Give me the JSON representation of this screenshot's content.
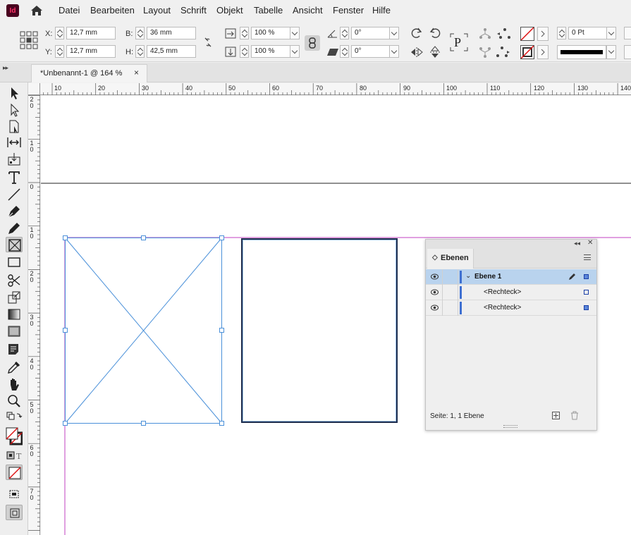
{
  "app": {
    "logo_text": "Id"
  },
  "menu": {
    "items": [
      {
        "label": "Datei"
      },
      {
        "label": "Bearbeiten"
      },
      {
        "label": "Layout"
      },
      {
        "label": "Schrift"
      },
      {
        "label": "Objekt"
      },
      {
        "label": "Tabelle"
      },
      {
        "label": "Ansicht"
      },
      {
        "label": "Fenster"
      },
      {
        "label": "Hilfe"
      }
    ]
  },
  "control": {
    "x_label": "X:",
    "x_value": "12,7 mm",
    "y_label": "Y:",
    "y_value": "12,7 mm",
    "w_label": "B:",
    "w_value": "36 mm",
    "h_label": "H:",
    "h_value": "42,5 mm",
    "scale_x": "100 %",
    "scale_y": "100 %",
    "rotation": "0°",
    "shear": "0°",
    "stroke_weight": "0 Pt",
    "para_icon_text": "P"
  },
  "tab": {
    "title": "*Unbenannt-1 @ 164 %",
    "close_glyph": "×"
  },
  "ruler": {
    "h_labels": [
      "10",
      "20",
      "30",
      "40",
      "50",
      "60",
      "70",
      "80",
      "90",
      "100",
      "110",
      "120",
      "130",
      "140"
    ],
    "v_labels": [
      "2 0",
      "1 0",
      "0",
      "1 0",
      "2 0",
      "3 0",
      "4 0",
      "5 0",
      "6 0",
      "7 0"
    ]
  },
  "layers": {
    "tab_label": "Ebenen",
    "rows": [
      {
        "name": "Ebene 1"
      },
      {
        "name": "<Rechteck>"
      },
      {
        "name": "<Rechteck>"
      }
    ],
    "footer": "Seite: 1, 1 Ebene"
  },
  "colors": {
    "frame_blue": "#4a90d9",
    "margin_magenta": "#c040c0",
    "layer_selected": "#b9d3ee",
    "layer_bar": "#3d6fd1"
  }
}
